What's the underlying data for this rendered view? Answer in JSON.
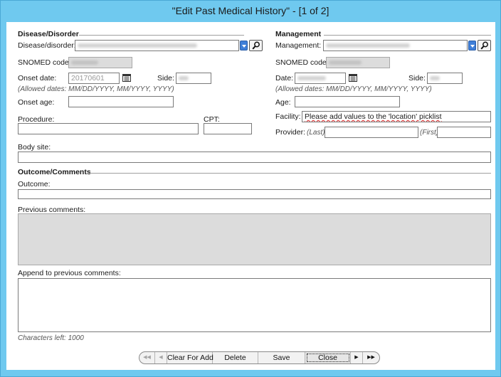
{
  "window": {
    "title": "\"Edit Past Medical History\" - [1 of 2]"
  },
  "disorder": {
    "section_title": "Disease/Disorder",
    "disease_label": "Disease/disorder:",
    "snomed_label": "SNOMED code:",
    "onset_date_label": "Onset date:",
    "onset_date_value": "20170601",
    "side_label": "Side:",
    "allowed_dates_hint": "(Allowed dates: MM/DD/YYYY, MM/YYYY, YYYY)",
    "onset_age_label": "Onset age:",
    "procedure_label": "Procedure:",
    "cpt_label": "CPT:",
    "body_site_label": "Body site:"
  },
  "management": {
    "section_title": "Management",
    "management_label": "Management:",
    "snomed_label": "SNOMED code:",
    "date_label": "Date:",
    "side_label": "Side:",
    "allowed_dates_hint": "(Allowed dates: MM/DD/YYYY, MM/YYYY, YYYY)",
    "age_label": "Age:",
    "facility_label": "Facility:",
    "facility_value": "Please add values to the 'location' picklist",
    "provider_label": "Provider:",
    "last_hint": "(Last)",
    "first_hint": "(First)"
  },
  "outcome": {
    "section_title": "Outcome/Comments",
    "outcome_label": "Outcome:",
    "previous_comments_label": "Previous comments:",
    "append_label": "Append to previous comments:",
    "characters_left": "Characters left: 1000"
  },
  "nav": {
    "first_symbol": "◀◀",
    "prev_symbol": "◀",
    "clear_for_add": "Clear For Add",
    "delete": "Delete",
    "save": "Save",
    "close": "Close",
    "next_symbol": "▶",
    "last_symbol": "▶▶"
  },
  "colors": {
    "title_bar": "#6fc9ef",
    "dropdown_button": "#3f7fd8",
    "readonly_field": "#dcdcdc"
  }
}
